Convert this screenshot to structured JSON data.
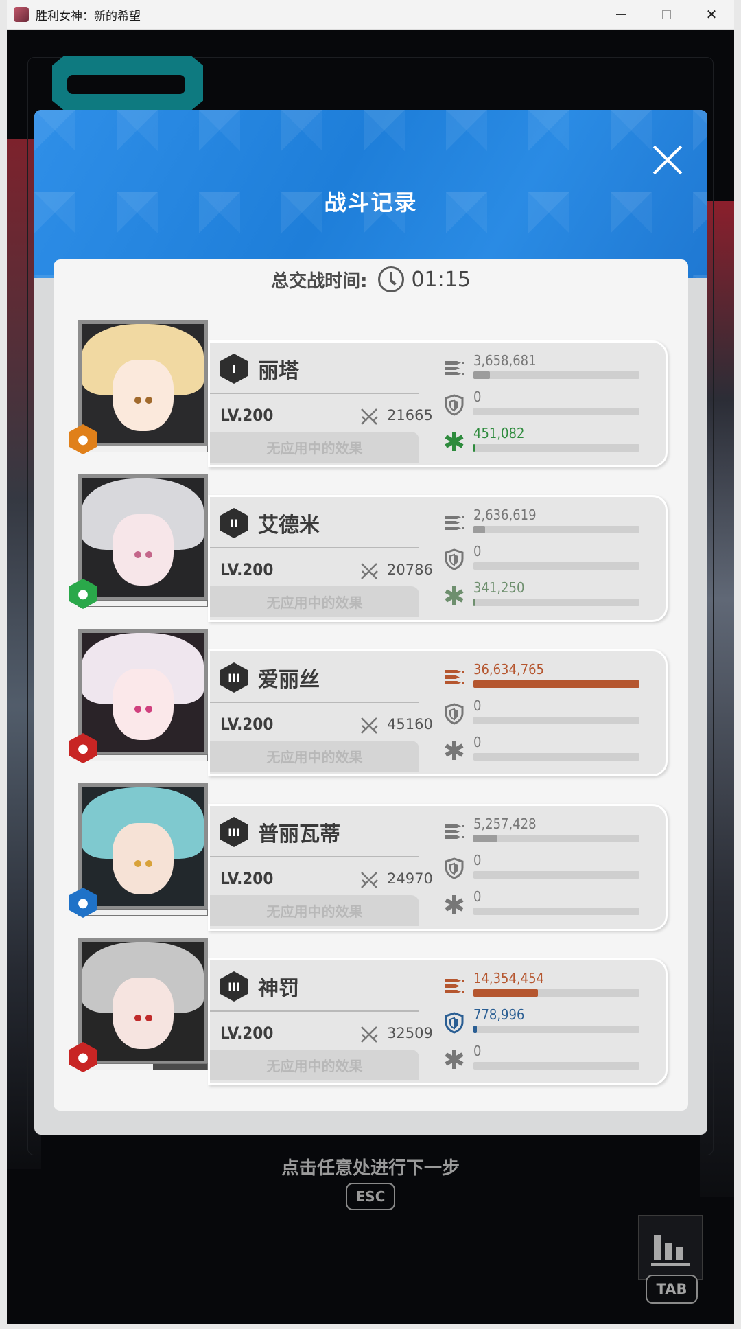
{
  "window": {
    "title": "胜利女神：新的希望",
    "minimize": "—",
    "close": "✕"
  },
  "dialog": {
    "title": "战斗记录",
    "battle_time_label": "总交战时间:",
    "battle_time_value": "01:15"
  },
  "colors": {
    "header_blue": "#1e7ed9",
    "damage_orange": "#b5562f",
    "heal_green": "#2e8b3d",
    "shield_blue": "#2a5e93",
    "neutral_gray": "#9c9c9c"
  },
  "characters": [
    {
      "name": "丽塔",
      "rank": "I",
      "level": "LV.200",
      "power": "21665",
      "effects": "无应用中的效果",
      "element_icon": "fire-element-honeycomb-icon",
      "element_color": "#e0801a",
      "damage": "3,658,681",
      "damage_fraction": 0.1,
      "damage_color": "#9c9c9c",
      "shield": "0",
      "shield_fraction": 0,
      "shield_color": "#9c9c9c",
      "heal": "451,082",
      "heal_fraction": 0.01,
      "heal_color": "#2e8b3d",
      "hp_fraction": 0
    },
    {
      "name": "艾德米",
      "rank": "II",
      "level": "LV.200",
      "power": "20786",
      "effects": "无应用中的效果",
      "element_icon": "wind-element-icon",
      "element_color": "#2aa84a",
      "damage": "2,636,619",
      "damage_fraction": 0.07,
      "damage_color": "#9c9c9c",
      "shield": "0",
      "shield_fraction": 0,
      "shield_color": "#9c9c9c",
      "heal": "341,250",
      "heal_fraction": 0.01,
      "heal_color": "#6e8f6e",
      "hp_fraction": 0
    },
    {
      "name": "爱丽丝",
      "rank": "III",
      "level": "LV.200",
      "power": "45160",
      "effects": "无应用中的效果",
      "element_icon": "fire-element-icon",
      "element_color": "#c82524",
      "damage": "36,634,765",
      "damage_fraction": 1.0,
      "damage_color": "#b5562f",
      "shield": "0",
      "shield_fraction": 0,
      "shield_color": "#9c9c9c",
      "heal": "0",
      "heal_fraction": 0,
      "heal_color": "#9c9c9c",
      "hp_fraction": 0
    },
    {
      "name": "普丽瓦蒂",
      "rank": "III",
      "level": "LV.200",
      "power": "24970",
      "effects": "无应用中的效果",
      "element_icon": "water-element-icon",
      "element_color": "#1f72c8",
      "damage": "5,257,428",
      "damage_fraction": 0.14,
      "damage_color": "#9c9c9c",
      "shield": "0",
      "shield_fraction": 0,
      "shield_color": "#9c9c9c",
      "heal": "0",
      "heal_fraction": 0,
      "heal_color": "#9c9c9c",
      "hp_fraction": 0
    },
    {
      "name": "神罚",
      "rank": "III",
      "level": "LV.200",
      "power": "32509",
      "effects": "无应用中的效果",
      "element_icon": "fire-element-icon",
      "element_color": "#c82524",
      "damage": "14,354,454",
      "damage_fraction": 0.39,
      "damage_color": "#b5562f",
      "shield": "778,996",
      "shield_fraction": 0.02,
      "shield_color": "#2a5e93",
      "heal": "0",
      "heal_fraction": 0,
      "heal_color": "#9c9c9c",
      "hp_fraction": 0.42
    }
  ],
  "footer": {
    "next_hint": "点击任意处进行下一步",
    "esc_key": "ESC",
    "tab_key": "TAB"
  }
}
